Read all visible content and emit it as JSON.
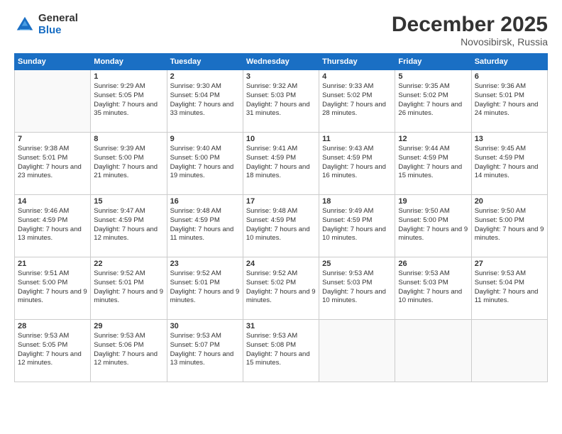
{
  "header": {
    "logo_general": "General",
    "logo_blue": "Blue",
    "month_title": "December 2025",
    "location": "Novosibirsk, Russia"
  },
  "weekdays": [
    "Sunday",
    "Monday",
    "Tuesday",
    "Wednesday",
    "Thursday",
    "Friday",
    "Saturday"
  ],
  "weeks": [
    [
      {
        "day": "",
        "sunrise": "",
        "sunset": "",
        "daylight": ""
      },
      {
        "day": "1",
        "sunrise": "Sunrise: 9:29 AM",
        "sunset": "Sunset: 5:05 PM",
        "daylight": "Daylight: 7 hours and 35 minutes."
      },
      {
        "day": "2",
        "sunrise": "Sunrise: 9:30 AM",
        "sunset": "Sunset: 5:04 PM",
        "daylight": "Daylight: 7 hours and 33 minutes."
      },
      {
        "day": "3",
        "sunrise": "Sunrise: 9:32 AM",
        "sunset": "Sunset: 5:03 PM",
        "daylight": "Daylight: 7 hours and 31 minutes."
      },
      {
        "day": "4",
        "sunrise": "Sunrise: 9:33 AM",
        "sunset": "Sunset: 5:02 PM",
        "daylight": "Daylight: 7 hours and 28 minutes."
      },
      {
        "day": "5",
        "sunrise": "Sunrise: 9:35 AM",
        "sunset": "Sunset: 5:02 PM",
        "daylight": "Daylight: 7 hours and 26 minutes."
      },
      {
        "day": "6",
        "sunrise": "Sunrise: 9:36 AM",
        "sunset": "Sunset: 5:01 PM",
        "daylight": "Daylight: 7 hours and 24 minutes."
      }
    ],
    [
      {
        "day": "7",
        "sunrise": "Sunrise: 9:38 AM",
        "sunset": "Sunset: 5:01 PM",
        "daylight": "Daylight: 7 hours and 23 minutes."
      },
      {
        "day": "8",
        "sunrise": "Sunrise: 9:39 AM",
        "sunset": "Sunset: 5:00 PM",
        "daylight": "Daylight: 7 hours and 21 minutes."
      },
      {
        "day": "9",
        "sunrise": "Sunrise: 9:40 AM",
        "sunset": "Sunset: 5:00 PM",
        "daylight": "Daylight: 7 hours and 19 minutes."
      },
      {
        "day": "10",
        "sunrise": "Sunrise: 9:41 AM",
        "sunset": "Sunset: 4:59 PM",
        "daylight": "Daylight: 7 hours and 18 minutes."
      },
      {
        "day": "11",
        "sunrise": "Sunrise: 9:43 AM",
        "sunset": "Sunset: 4:59 PM",
        "daylight": "Daylight: 7 hours and 16 minutes."
      },
      {
        "day": "12",
        "sunrise": "Sunrise: 9:44 AM",
        "sunset": "Sunset: 4:59 PM",
        "daylight": "Daylight: 7 hours and 15 minutes."
      },
      {
        "day": "13",
        "sunrise": "Sunrise: 9:45 AM",
        "sunset": "Sunset: 4:59 PM",
        "daylight": "Daylight: 7 hours and 14 minutes."
      }
    ],
    [
      {
        "day": "14",
        "sunrise": "Sunrise: 9:46 AM",
        "sunset": "Sunset: 4:59 PM",
        "daylight": "Daylight: 7 hours and 13 minutes."
      },
      {
        "day": "15",
        "sunrise": "Sunrise: 9:47 AM",
        "sunset": "Sunset: 4:59 PM",
        "daylight": "Daylight: 7 hours and 12 minutes."
      },
      {
        "day": "16",
        "sunrise": "Sunrise: 9:48 AM",
        "sunset": "Sunset: 4:59 PM",
        "daylight": "Daylight: 7 hours and 11 minutes."
      },
      {
        "day": "17",
        "sunrise": "Sunrise: 9:48 AM",
        "sunset": "Sunset: 4:59 PM",
        "daylight": "Daylight: 7 hours and 10 minutes."
      },
      {
        "day": "18",
        "sunrise": "Sunrise: 9:49 AM",
        "sunset": "Sunset: 4:59 PM",
        "daylight": "Daylight: 7 hours and 10 minutes."
      },
      {
        "day": "19",
        "sunrise": "Sunrise: 9:50 AM",
        "sunset": "Sunset: 5:00 PM",
        "daylight": "Daylight: 7 hours and 9 minutes."
      },
      {
        "day": "20",
        "sunrise": "Sunrise: 9:50 AM",
        "sunset": "Sunset: 5:00 PM",
        "daylight": "Daylight: 7 hours and 9 minutes."
      }
    ],
    [
      {
        "day": "21",
        "sunrise": "Sunrise: 9:51 AM",
        "sunset": "Sunset: 5:00 PM",
        "daylight": "Daylight: 7 hours and 9 minutes."
      },
      {
        "day": "22",
        "sunrise": "Sunrise: 9:52 AM",
        "sunset": "Sunset: 5:01 PM",
        "daylight": "Daylight: 7 hours and 9 minutes."
      },
      {
        "day": "23",
        "sunrise": "Sunrise: 9:52 AM",
        "sunset": "Sunset: 5:01 PM",
        "daylight": "Daylight: 7 hours and 9 minutes."
      },
      {
        "day": "24",
        "sunrise": "Sunrise: 9:52 AM",
        "sunset": "Sunset: 5:02 PM",
        "daylight": "Daylight: 7 hours and 9 minutes."
      },
      {
        "day": "25",
        "sunrise": "Sunrise: 9:53 AM",
        "sunset": "Sunset: 5:03 PM",
        "daylight": "Daylight: 7 hours and 10 minutes."
      },
      {
        "day": "26",
        "sunrise": "Sunrise: 9:53 AM",
        "sunset": "Sunset: 5:03 PM",
        "daylight": "Daylight: 7 hours and 10 minutes."
      },
      {
        "day": "27",
        "sunrise": "Sunrise: 9:53 AM",
        "sunset": "Sunset: 5:04 PM",
        "daylight": "Daylight: 7 hours and 11 minutes."
      }
    ],
    [
      {
        "day": "28",
        "sunrise": "Sunrise: 9:53 AM",
        "sunset": "Sunset: 5:05 PM",
        "daylight": "Daylight: 7 hours and 12 minutes."
      },
      {
        "day": "29",
        "sunrise": "Sunrise: 9:53 AM",
        "sunset": "Sunset: 5:06 PM",
        "daylight": "Daylight: 7 hours and 12 minutes."
      },
      {
        "day": "30",
        "sunrise": "Sunrise: 9:53 AM",
        "sunset": "Sunset: 5:07 PM",
        "daylight": "Daylight: 7 hours and 13 minutes."
      },
      {
        "day": "31",
        "sunrise": "Sunrise: 9:53 AM",
        "sunset": "Sunset: 5:08 PM",
        "daylight": "Daylight: 7 hours and 15 minutes."
      },
      {
        "day": "",
        "sunrise": "",
        "sunset": "",
        "daylight": ""
      },
      {
        "day": "",
        "sunrise": "",
        "sunset": "",
        "daylight": ""
      },
      {
        "day": "",
        "sunrise": "",
        "sunset": "",
        "daylight": ""
      }
    ]
  ]
}
